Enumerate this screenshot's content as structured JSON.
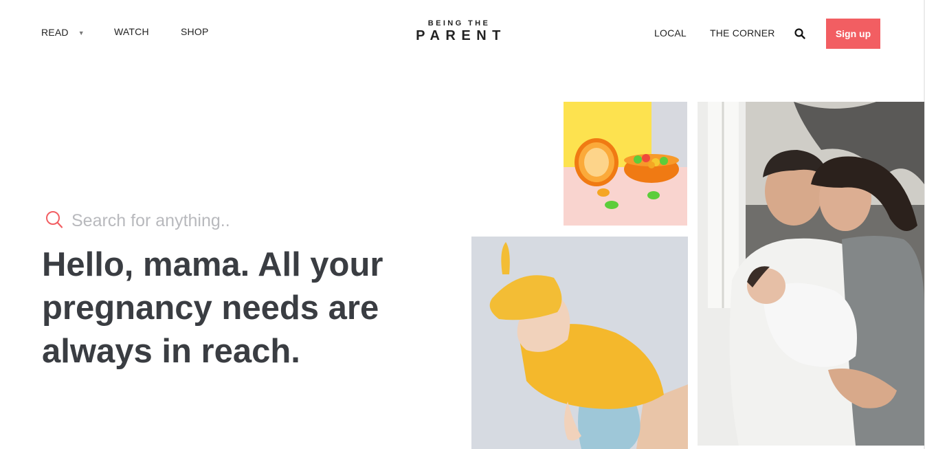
{
  "nav": {
    "read": "READ",
    "watch": "WATCH",
    "shop": "SHOP",
    "local": "LOCAL",
    "corner": "THE CORNER",
    "signup": "Sign up"
  },
  "logo": {
    "top": "BEING THE",
    "bottom": "PARENT"
  },
  "hero": {
    "search_placeholder": "Search for anything..",
    "title": "Hello, mama. All your pregnancy needs are always in reach."
  },
  "colors": {
    "accent": "#f25e62",
    "heading": "#3a3d42",
    "placeholder": "#b8b9bd"
  },
  "icons": {
    "search": "search-icon",
    "read_dropdown": "chevron-down-icon"
  }
}
